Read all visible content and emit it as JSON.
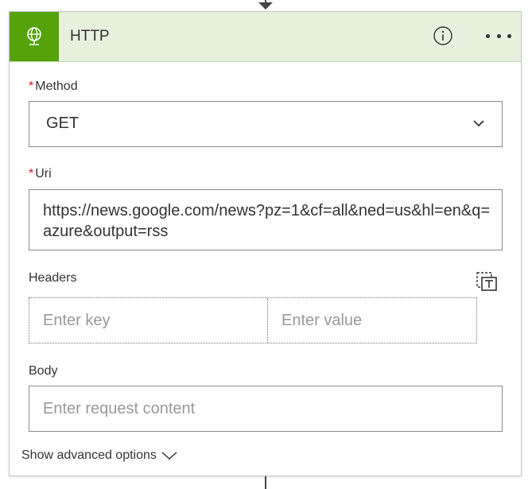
{
  "card": {
    "title": "HTTP",
    "colors": {
      "icon_bg": "#56a20a",
      "header_bg": "#e8f0de",
      "required": "#e81123"
    },
    "icons": {
      "action": "globe-icon",
      "info": "info-icon",
      "more": "ellipsis-icon"
    }
  },
  "method": {
    "label": "Method",
    "required_marker": "*",
    "value": "GET"
  },
  "uri": {
    "label": "Uri",
    "required_marker": "*",
    "value": "https://news.google.com/news?pz=1&cf=all&ned=us&hl=en&q=azure&output=rss"
  },
  "headers": {
    "label": "Headers",
    "key_placeholder": "Enter key",
    "value_placeholder": "Enter value",
    "mode_icon": "text-mode-icon"
  },
  "body": {
    "label": "Body",
    "placeholder": "Enter request content"
  },
  "advanced": {
    "label": "Show advanced options"
  }
}
